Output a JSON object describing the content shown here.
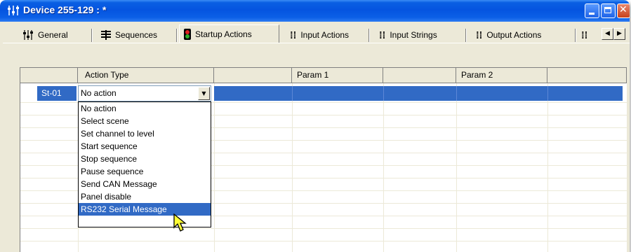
{
  "window": {
    "title": "Device 255-129 : *"
  },
  "tabs": [
    {
      "label": "General",
      "icon": "sliders-icon"
    },
    {
      "label": "Sequences",
      "icon": "list-icon"
    },
    {
      "label": "Startup Actions",
      "icon": "traffic-light-icon"
    },
    {
      "label": "Input Actions",
      "icon": "dots-icon"
    },
    {
      "label": "Input Strings",
      "icon": "dots-icon"
    },
    {
      "label": "Output Actions",
      "icon": "dots-icon"
    }
  ],
  "grid": {
    "columns": [
      "Action Type",
      "",
      "Param 1",
      "",
      "Param 2",
      ""
    ],
    "rows": [
      {
        "id": "St-01",
        "action": "No action"
      }
    ]
  },
  "dropdown": {
    "options": [
      "No action",
      "Select scene",
      "Set channel to level",
      "Start sequence",
      "Stop sequence",
      "Pause sequence",
      "Send CAN Message",
      "Panel disable",
      "RS232 Serial Message"
    ],
    "highlighted": "RS232 Serial Message"
  },
  "colors": {
    "selection": "#316ac5",
    "titlebar": "#0554e0",
    "face": "#ece9d8"
  }
}
